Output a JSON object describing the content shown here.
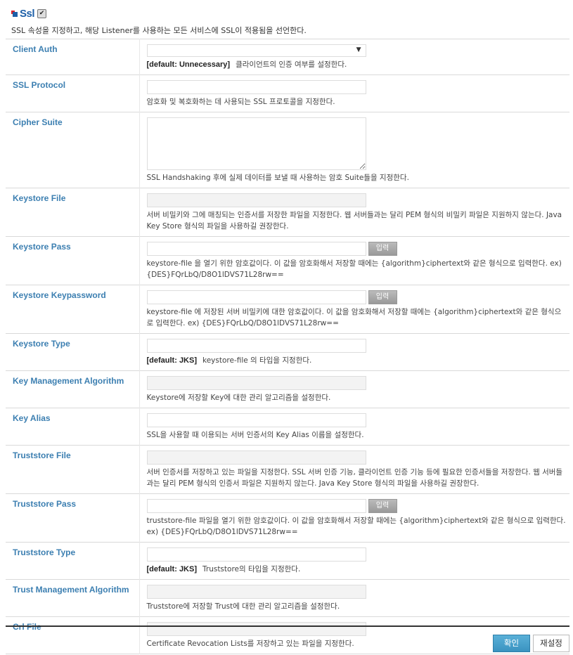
{
  "header": {
    "title": "Ssl",
    "enabled": true,
    "description": "SSL 속성을 지정하고, 해당 Listener를 사용하는 모든 서비스에 SSL이 적용됨을 선언한다."
  },
  "colors": {
    "label": "#3c7fb1",
    "title": "#1d5fa8",
    "confirm": "#3a93c0"
  },
  "input_button_label": "입력",
  "rows": [
    {
      "label": "Client Auth",
      "type": "select",
      "value": "",
      "default": "[default: Unnecessary]",
      "desc": "클라이언트의 인증 여부를 설정한다."
    },
    {
      "label": "SSL Protocol",
      "type": "text",
      "value": "",
      "desc": "암호화 및 복호화하는 데 사용되는 SSL 프로토콜을 지정한다."
    },
    {
      "label": "Cipher Suite",
      "type": "textarea",
      "value": "",
      "desc": "SSL Handshaking 후에 실제 데이터를 보낼 때 사용하는 암호 Suite들을 지정한다."
    },
    {
      "label": "Keystore File",
      "type": "text",
      "disabled": true,
      "value": "",
      "desc": "서버 비밀키와 그에 매칭되는 인증서를 저장한 파일을 지정한다. 웹 서버들과는 달리 PEM 형식의 비밀키 파일은 지원하지 않는다. Java Key Store 형식의 파일을 사용하길 권장한다."
    },
    {
      "label": "Keystore Pass",
      "type": "password",
      "value": "",
      "desc": "keystore-file 을 열기 위한 암호값이다. 이 값을 암호화해서 저장할 때에는 {algorithm}ciphertext와 같은 형식으로 입력한다. ex) {DES}FQrLbQ/D8O1lDVS71L28rw=="
    },
    {
      "label": "Keystore Keypassword",
      "type": "password",
      "value": "",
      "desc": "keystore-file 에 저장된 서버 비밀키에 대한 암호값이다. 이 값을 암호화해서 저장할 때에는 {algorithm}ciphertext와 같은 형식으로 입력한다. ex) {DES}FQrLbQ/D8O1lDVS71L28rw=="
    },
    {
      "label": "Keystore Type",
      "type": "text",
      "value": "",
      "default": "[default: JKS]",
      "desc": "keystore-file 의 타입을 지정한다."
    },
    {
      "label": "Key Management Algorithm",
      "type": "text",
      "disabled": true,
      "value": "",
      "desc": "Keystore에 저장할 Key에 대한 관리 알고리즘을 설정한다."
    },
    {
      "label": "Key Alias",
      "type": "text",
      "value": "",
      "desc": "SSL을 사용할 때 이용되는 서버 인증서의 Key Alias 이름을 설정한다."
    },
    {
      "label": "Truststore File",
      "type": "text",
      "disabled": true,
      "value": "",
      "desc": "서버 인증서를 저장하고 있는 파일을 지정한다. SSL 서버 인증 기능, 클라이언트 인증 기능 등에 필요한 인증서들을 저장한다. 웹 서버들과는 달리 PEM 형식의 인증서 파일은 지원하지 않는다. Java Key Store 형식의 파일을 사용하길 권장한다."
    },
    {
      "label": "Truststore Pass",
      "type": "password",
      "value": "",
      "desc": "truststore-file 파일을 열기 위한 암호값이다. 이 값을 암호화해서 저장할 때에는 {algorithm}ciphertext와 같은 형식으로 입력한다. ex) {DES}FQrLbQ/D8O1lDVS71L28rw=="
    },
    {
      "label": "Truststore Type",
      "type": "text",
      "value": "",
      "default": "[default: JKS]",
      "desc": "Truststore의 타입을 지정한다."
    },
    {
      "label": "Trust Management Algorithm",
      "type": "text",
      "disabled": true,
      "value": "",
      "desc": "Truststore에 저장할 Trust에 대한 관리 알고리즘을 설정한다."
    },
    {
      "label": "Crl File",
      "type": "text",
      "disabled": true,
      "value": "",
      "desc": "Certificate Revocation Lists를 저장하고 있는 파일을 지정한다."
    }
  ],
  "footer": {
    "confirm_label": "확인",
    "reset_label": "재설정"
  }
}
